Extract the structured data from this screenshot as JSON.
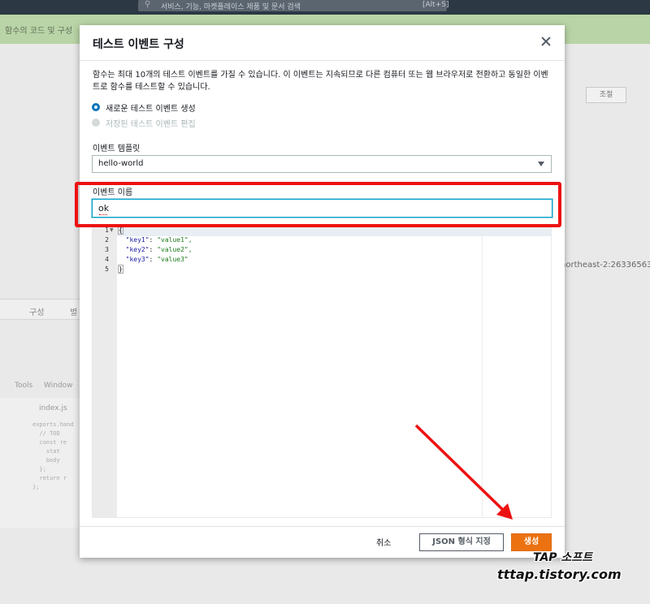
{
  "background": {
    "search_hint": "서비스, 기능, 마켓플레이스 제품 및 문서 검색",
    "search_shortcut": "[Alt+S]",
    "notice": "함수의 코드 및 구성",
    "throttle_button": "조절",
    "region_fragment": "northeast-2:26336563",
    "tabs": [
      "구성",
      "별"
    ],
    "menu": [
      "Tools",
      "Window"
    ],
    "file_tab": "index.js",
    "code_lines": [
      "exports.hand",
      "  // TOD",
      "  const re",
      "    stat",
      "    body",
      "  };",
      "  return r",
      "};"
    ]
  },
  "modal": {
    "title": "테스트 이벤트 구성",
    "description": "함수는 최대 10개의 테스트 이벤트를 가질 수 있습니다. 이 이벤트는 지속되므로 다른 컴퓨터 또는 웹 브라우저로 전환하고 동일한 이벤트로 함수를 테스트할 수 있습니다.",
    "radio_new": "새로운 테스트 이벤트 생성",
    "radio_edit": "저장된 테스트 이벤트 편집",
    "template_label": "이벤트 템플릿",
    "template_value": "hello-world",
    "name_label": "이벤트 이름",
    "name_value": "ok",
    "editor": {
      "line_numbers": [
        "1",
        "2",
        "3",
        "4",
        "5"
      ],
      "open_brace": "{",
      "lines": [
        {
          "key": "\"key1\"",
          "value": "\"value1\","
        },
        {
          "key": "\"key2\"",
          "value": "\"value2\","
        },
        {
          "key": "\"key3\"",
          "value": "\"value3\""
        }
      ],
      "close_brace": "}"
    },
    "footer": {
      "cancel": "취소",
      "format_json": "JSON 형식 지정",
      "create": "생성"
    }
  },
  "watermark": {
    "line1": "TAP 소프트",
    "line2": "tttap.tistory.com"
  },
  "colors": {
    "accent_orange": "#ec7211",
    "focus_blue": "#00a1c9",
    "annotation_red": "#ee1111"
  }
}
